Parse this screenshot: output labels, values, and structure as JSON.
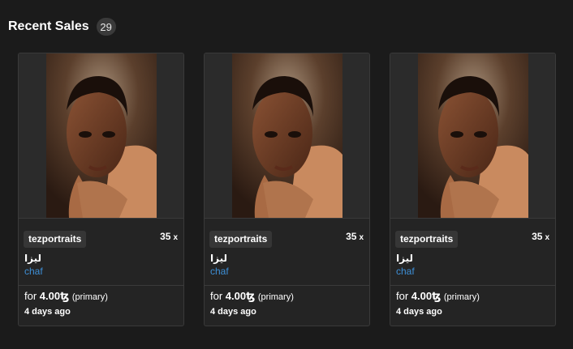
{
  "header": {
    "title": "Recent Sales",
    "count": "29"
  },
  "sales": [
    {
      "artwork_icon": "portrait-painting",
      "creator": "tezportraits",
      "editions": "35",
      "editions_suffix": "x",
      "title": "لیزا",
      "collection": "chaf",
      "for_label": "for",
      "price": "4.00ꜩ",
      "sale_type": "(primary)",
      "time": "4 days ago"
    },
    {
      "artwork_icon": "portrait-painting",
      "creator": "tezportraits",
      "editions": "35",
      "editions_suffix": "x",
      "title": "لیزا",
      "collection": "chaf",
      "for_label": "for",
      "price": "4.00ꜩ",
      "sale_type": "(primary)",
      "time": "4 days ago"
    },
    {
      "artwork_icon": "portrait-painting",
      "creator": "tezportraits",
      "editions": "35",
      "editions_suffix": "x",
      "title": "لیزا",
      "collection": "chaf",
      "for_label": "for",
      "price": "4.00ꜩ",
      "sale_type": "(primary)",
      "time": "4 days ago"
    }
  ],
  "colors": {
    "background": "#1b1b1b",
    "card": "#242424",
    "link": "#3d8fd6"
  }
}
